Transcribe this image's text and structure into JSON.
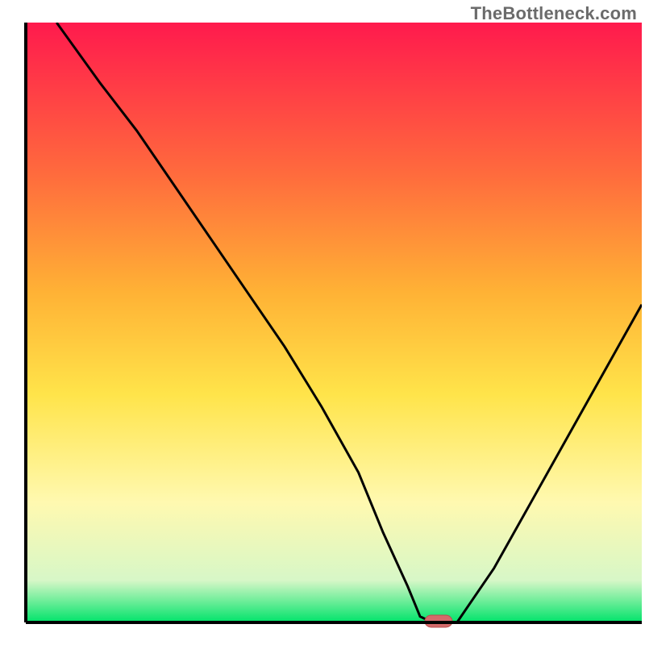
{
  "watermark": "TheBottleneck.com",
  "colors": {
    "gradient_top": "#ff1a4d",
    "gradient_mid1": "#ff6a3d",
    "gradient_mid2": "#ffb235",
    "gradient_mid3": "#ffe44a",
    "gradient_mid4": "#fff9b0",
    "gradient_bottom_pale": "#d7f7c7",
    "gradient_bottom": "#00e36a",
    "axis": "#000000",
    "curve": "#000000",
    "marker_fill": "#d46a6a",
    "marker_stroke": "#b94e4e"
  },
  "chart_data": {
    "type": "line",
    "title": "",
    "xlabel": "",
    "ylabel": "",
    "xlim": [
      0,
      100
    ],
    "ylim": [
      0,
      100
    ],
    "grid": false,
    "legend": false,
    "series": [
      {
        "name": "bottleneck-curve",
        "x": [
          5,
          12,
          18,
          24,
          30,
          36,
          42,
          48,
          54,
          58,
          62,
          64,
          66,
          70,
          76,
          82,
          88,
          94,
          100
        ],
        "y": [
          100,
          90,
          82,
          73,
          64,
          55,
          46,
          36,
          25,
          15,
          6,
          1,
          0,
          0,
          9,
          20,
          31,
          42,
          53
        ]
      }
    ],
    "marker": {
      "x": 67,
      "y": 0,
      "shape": "pill"
    },
    "annotations": []
  }
}
